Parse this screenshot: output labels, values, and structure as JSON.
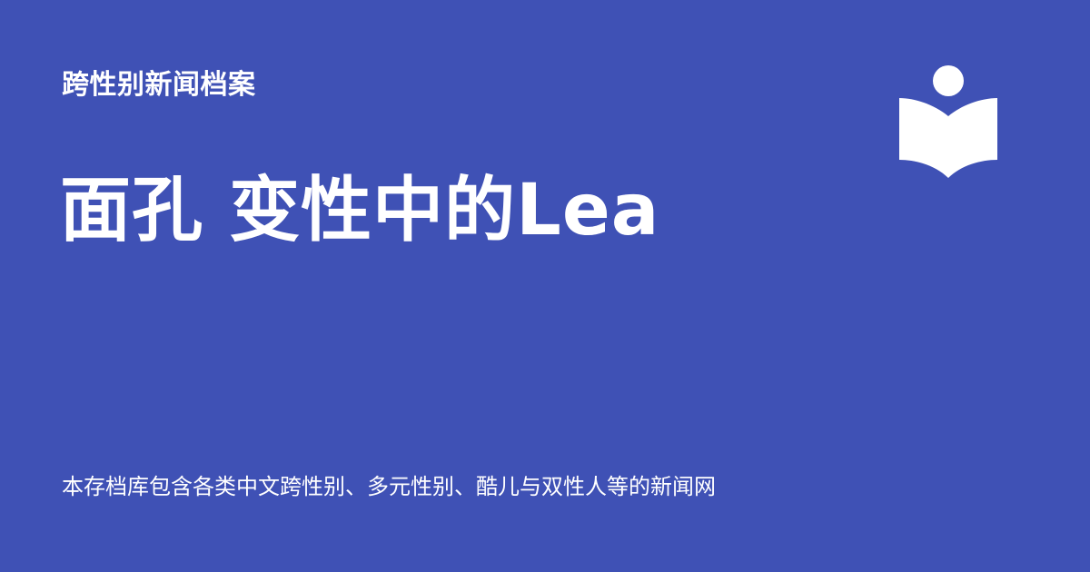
{
  "site": {
    "name": "跨性别新闻档案"
  },
  "page": {
    "title": "面孔 变性中的Lea",
    "description": "本存档库包含各类中文跨性别、多元性别、酷儿与双性人等的新闻网"
  },
  "logo": {
    "icon": "open-book-reader-icon"
  },
  "colors": {
    "background": "#3f51b5",
    "text": "#ffffff"
  }
}
